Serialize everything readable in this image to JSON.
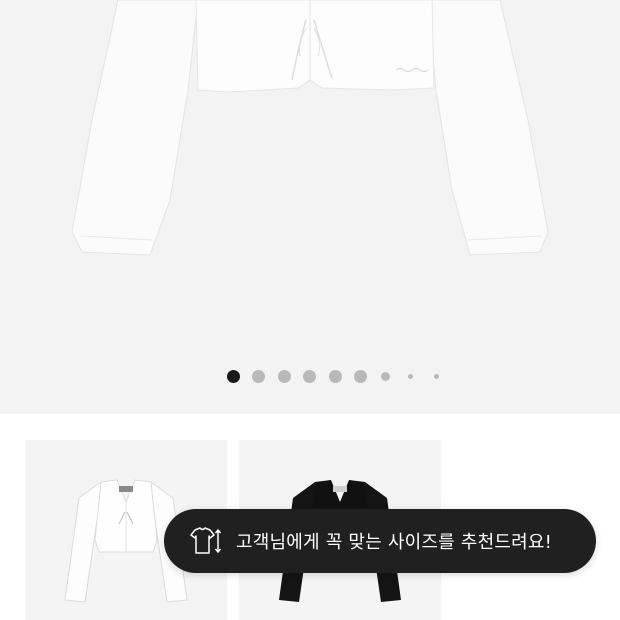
{
  "gallery": {
    "slide_count": 9,
    "active_index": 0,
    "main_image": "white-cropped-cardigan-photo"
  },
  "related_products": [
    {
      "image": "white-cropped-cardigan-thumbnail",
      "color": "#ffffff"
    },
    {
      "image": "black-cropped-cardigan-thumbnail",
      "color": "#111111"
    }
  ],
  "size_toast": {
    "icon": "tshirt-size-icon",
    "text": "고객님에게 꼭 맞는 사이즈를 추천드려요!"
  },
  "colors": {
    "background": "#f3f3f3",
    "dot_active": "#1a1a1a",
    "dot_inactive": "#b9b9b9",
    "toast_background": "#202020",
    "toast_text": "#ffffff"
  }
}
